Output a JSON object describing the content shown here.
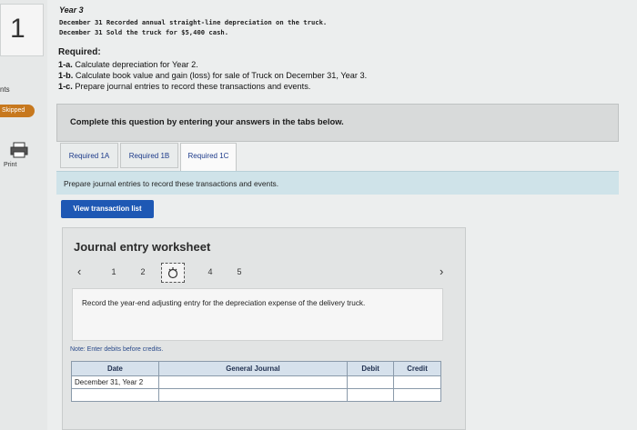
{
  "question": {
    "number": "1",
    "points_label": "nts",
    "status_badge": "Skipped",
    "print_label": "Print"
  },
  "problem": {
    "year_title": "Year 3",
    "lines": [
      "December 31 Recorded annual straight-line depreciation on the truck.",
      "December 31 Sold the truck for $5,400 cash."
    ],
    "required_heading": "Required:",
    "requirements": [
      {
        "id": "1-a.",
        "text": "Calculate depreciation for Year 2."
      },
      {
        "id": "1-b.",
        "text": "Calculate book value and gain (loss) for sale of Truck on December 31, Year 3."
      },
      {
        "id": "1-c.",
        "text": "Prepare journal entries to record these transactions and events."
      }
    ]
  },
  "instruction": "Complete this question by entering your answers in the tabs below.",
  "tabs": [
    {
      "label": "Required 1A"
    },
    {
      "label": "Required 1B"
    },
    {
      "label": "Required 1C"
    }
  ],
  "tab_content": "Prepare journal entries to record these transactions and events.",
  "view_button": "View transaction list",
  "worksheet": {
    "title": "Journal entry worksheet",
    "pages": [
      "1",
      "2",
      "3",
      "4",
      "5"
    ],
    "current_page": "3",
    "entry_description": "Record the year-end adjusting entry for the depreciation expense of the delivery truck.",
    "note": "Note: Enter debits before credits.",
    "columns": {
      "date": "Date",
      "account": "General Journal",
      "debit": "Debit",
      "credit": "Credit"
    },
    "rows": [
      {
        "date": "December 31, Year 2",
        "account": "",
        "debit": "",
        "credit": ""
      },
      {
        "date": "",
        "account": "",
        "debit": "",
        "credit": ""
      }
    ]
  }
}
